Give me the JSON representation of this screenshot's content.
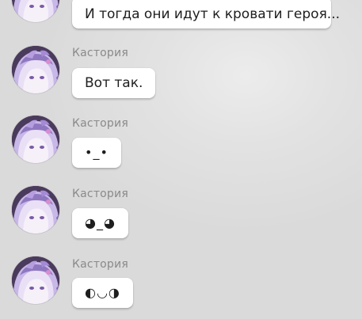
{
  "messages": [
    {
      "sender": "",
      "text": "И тогда они идут к кровати героя..."
    },
    {
      "sender": "Кастория",
      "text": "Вот так."
    },
    {
      "sender": "Кастория",
      "text": "•_•"
    },
    {
      "sender": "Кастория",
      "text": "◕_◕"
    },
    {
      "sender": "Кастория",
      "text": "◐◡◑"
    }
  ],
  "colors": {
    "bubble": "#ffffff",
    "sender_name": "#8a8a8a",
    "text": "#1e1e1e",
    "avatar_hair": "#b9a4dc",
    "avatar_bg": "#3a2b4a"
  },
  "icons": {
    "avatar": "castorice-avatar-icon"
  }
}
